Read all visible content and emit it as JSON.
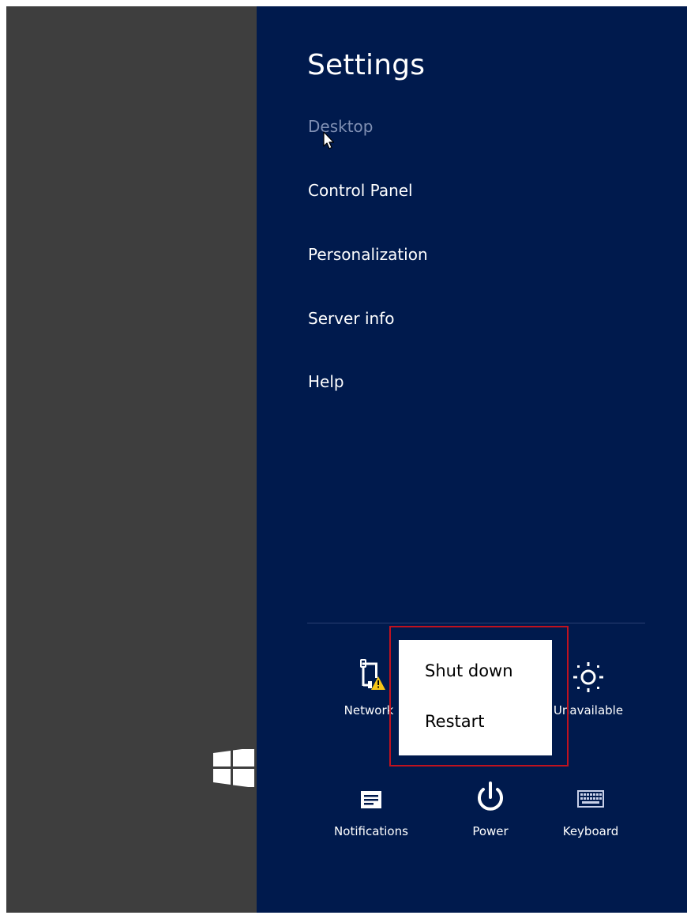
{
  "charm": {
    "title": "Settings",
    "links": [
      {
        "label": "Desktop",
        "state": "hover"
      },
      {
        "label": "Control Panel"
      },
      {
        "label": "Personalization"
      },
      {
        "label": "Server info"
      },
      {
        "label": "Help"
      }
    ]
  },
  "quick_settings": {
    "network": {
      "label": "Network",
      "icon": "network-warning-icon"
    },
    "brightness": {
      "label": "Unavailable",
      "icon": "brightness-icon"
    },
    "notifications": {
      "label": "Notifications",
      "icon": "notifications-icon"
    },
    "power": {
      "label": "Power",
      "icon": "power-icon"
    },
    "keyboard": {
      "label": "Keyboard",
      "icon": "keyboard-icon"
    }
  },
  "power_menu": {
    "items": [
      "Shut down",
      "Restart"
    ],
    "highlight_color": "#c0121f"
  },
  "colors": {
    "charm_background": "#001a4d",
    "desktop_background": "#3e3e3e",
    "warning": "#f5c518"
  }
}
